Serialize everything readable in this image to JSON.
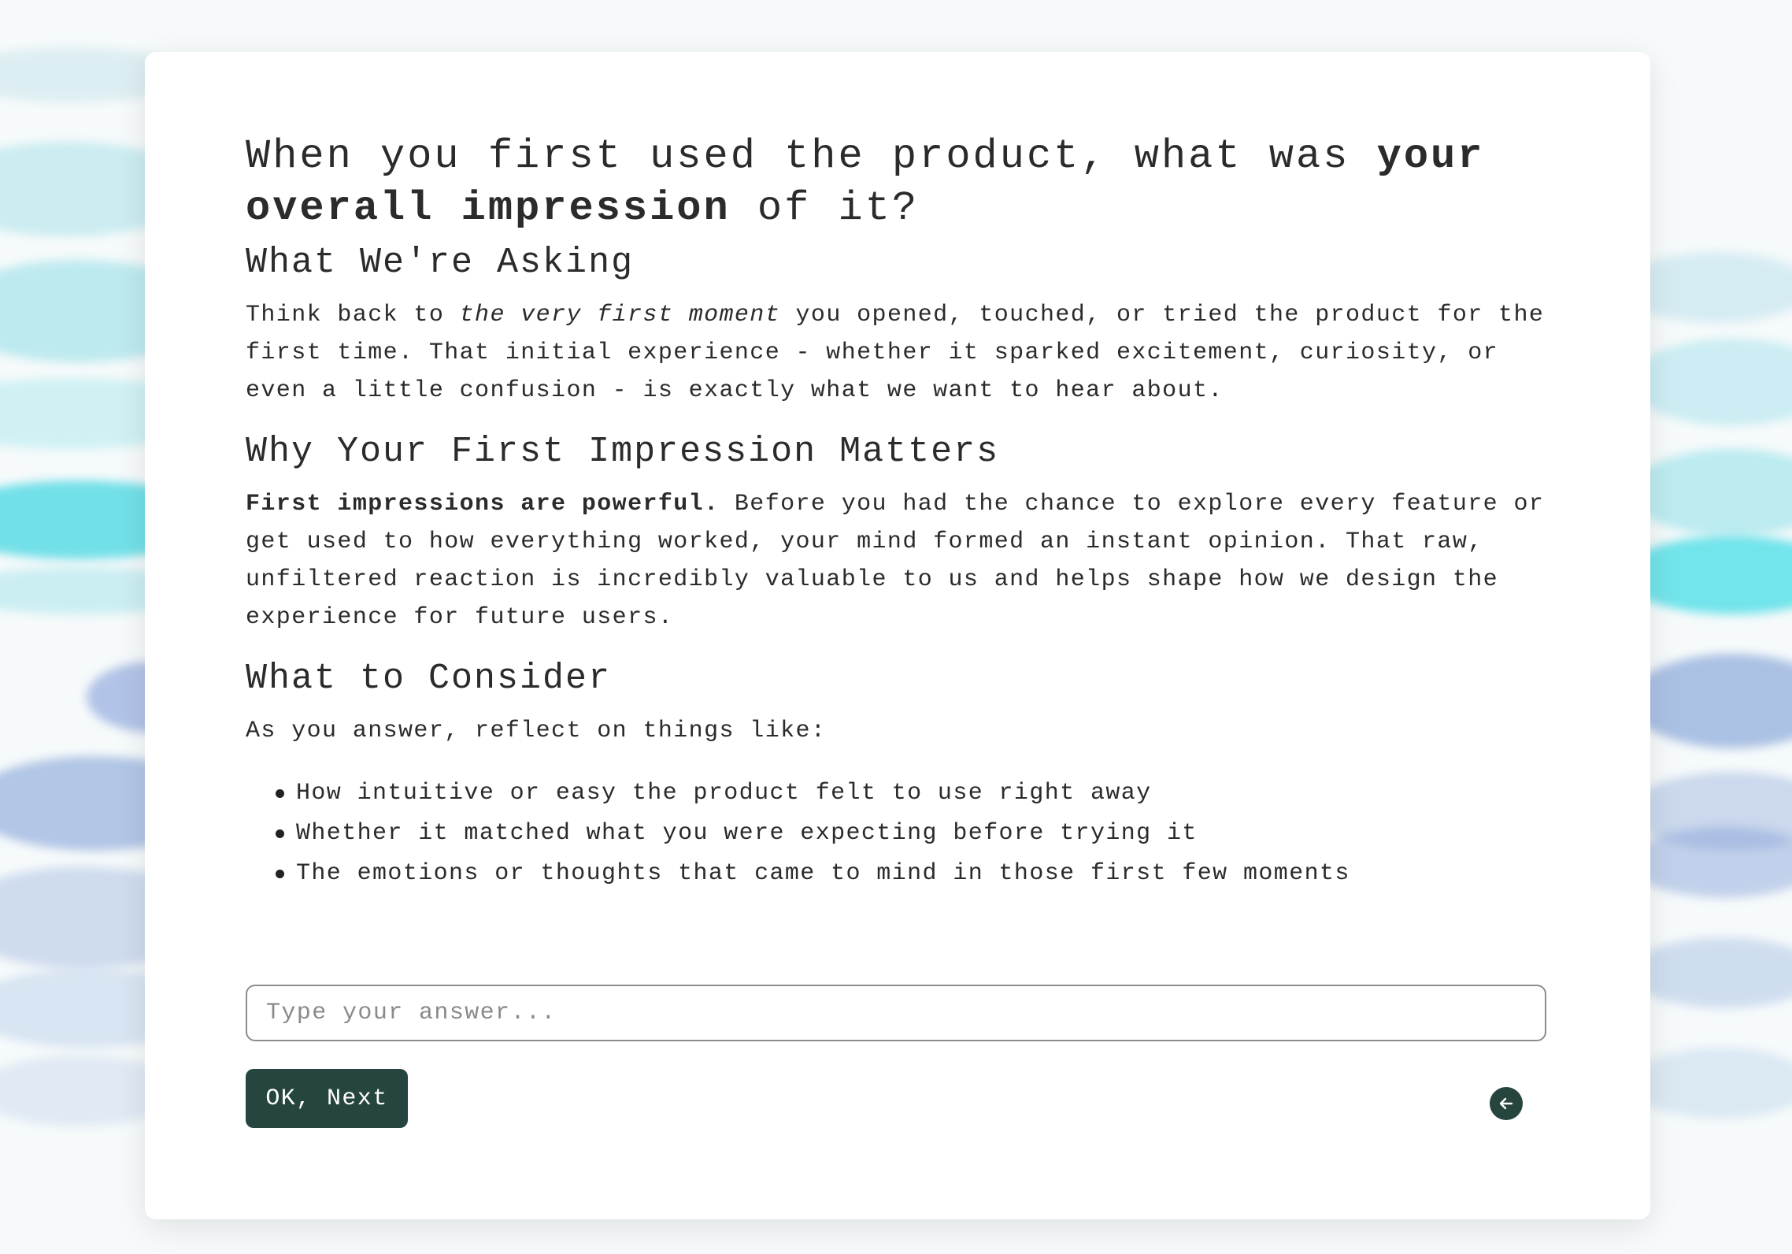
{
  "question": {
    "prefix": "When you first used the product, what was ",
    "bold": "your overall impression",
    "suffix": " of it?"
  },
  "sections": {
    "asking": {
      "heading": "What We're Asking",
      "text_1": "Think back to ",
      "emphasis": "the very first moment",
      "text_2": " you opened, touched, or tried the product for the first time. That initial experience - whether it sparked excitement, curiosity, or even a little confusion - is exactly what we want to hear about."
    },
    "matters": {
      "heading": "Why Your First Impression Matters",
      "bold_lead": "First impressions are powerful.",
      "text": " Before you had the chance to explore every feature or get used to how everything worked, your mind formed an instant opinion. That raw, unfiltered reaction is incredibly valuable to us and helps shape how we design the experience for future users."
    },
    "consider": {
      "heading": "What to Consider",
      "intro": "As you answer, reflect on things like:",
      "items": [
        "How intuitive or easy the product felt to use right away",
        "Whether it matched what you were expecting before trying it",
        "The emotions or thoughts that came to mind in those first few moments"
      ]
    }
  },
  "answer": {
    "placeholder": "Type your answer...",
    "value": ""
  },
  "buttons": {
    "ok_label": "OK, Next",
    "back_icon": "arrow-left-icon"
  },
  "colors": {
    "accent": "#25453e",
    "background_strokes": [
      "#4fd8e3",
      "#7fa4d9",
      "#b7ecef"
    ]
  }
}
